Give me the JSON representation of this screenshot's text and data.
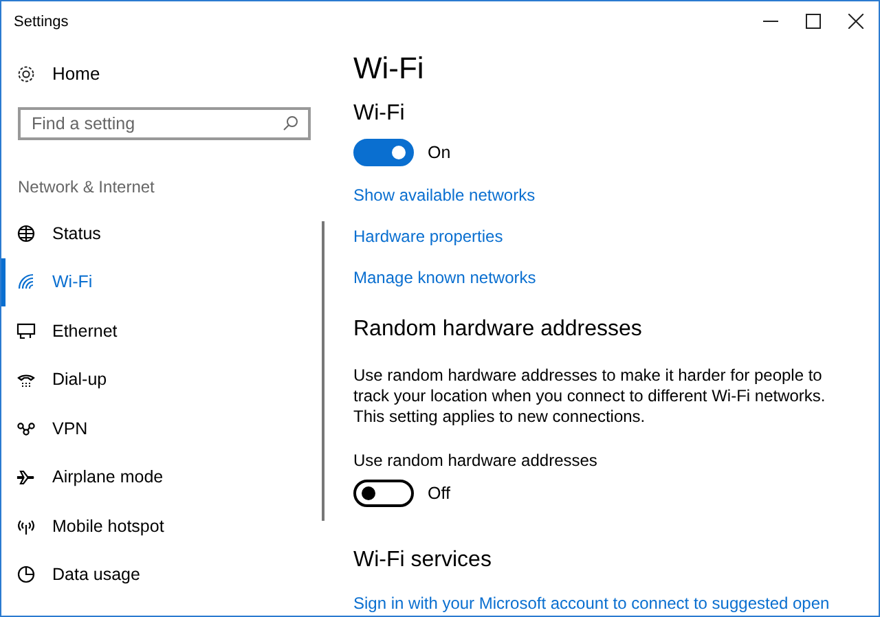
{
  "window": {
    "title": "Settings"
  },
  "sidebar": {
    "home": {
      "label": "Home"
    },
    "search": {
      "placeholder": "Find a setting"
    },
    "group_label": "Network & Internet",
    "items": [
      {
        "label": "Status",
        "selected": false
      },
      {
        "label": "Wi-Fi",
        "selected": true
      },
      {
        "label": "Ethernet",
        "selected": false
      },
      {
        "label": "Dial-up",
        "selected": false
      },
      {
        "label": "VPN",
        "selected": false
      },
      {
        "label": "Airplane mode",
        "selected": false
      },
      {
        "label": "Mobile hotspot",
        "selected": false
      },
      {
        "label": "Data usage",
        "selected": false
      }
    ]
  },
  "content": {
    "title": "Wi-Fi",
    "wifi": {
      "heading": "Wi-Fi",
      "toggle": {
        "on": true,
        "label": "On"
      }
    },
    "links": [
      "Show available networks",
      "Hardware properties",
      "Manage known networks"
    ],
    "random": {
      "heading": "Random hardware addresses",
      "description": "Use random hardware addresses to make it harder for people to track your location when you connect to different Wi-Fi networks. This setting applies to new connections.",
      "toggle_label": "Use random hardware addresses",
      "toggle": {
        "on": false,
        "label": "Off"
      }
    },
    "services": {
      "heading": "Wi-Fi services",
      "link": "Sign in with your Microsoft account to connect to suggested open"
    }
  }
}
